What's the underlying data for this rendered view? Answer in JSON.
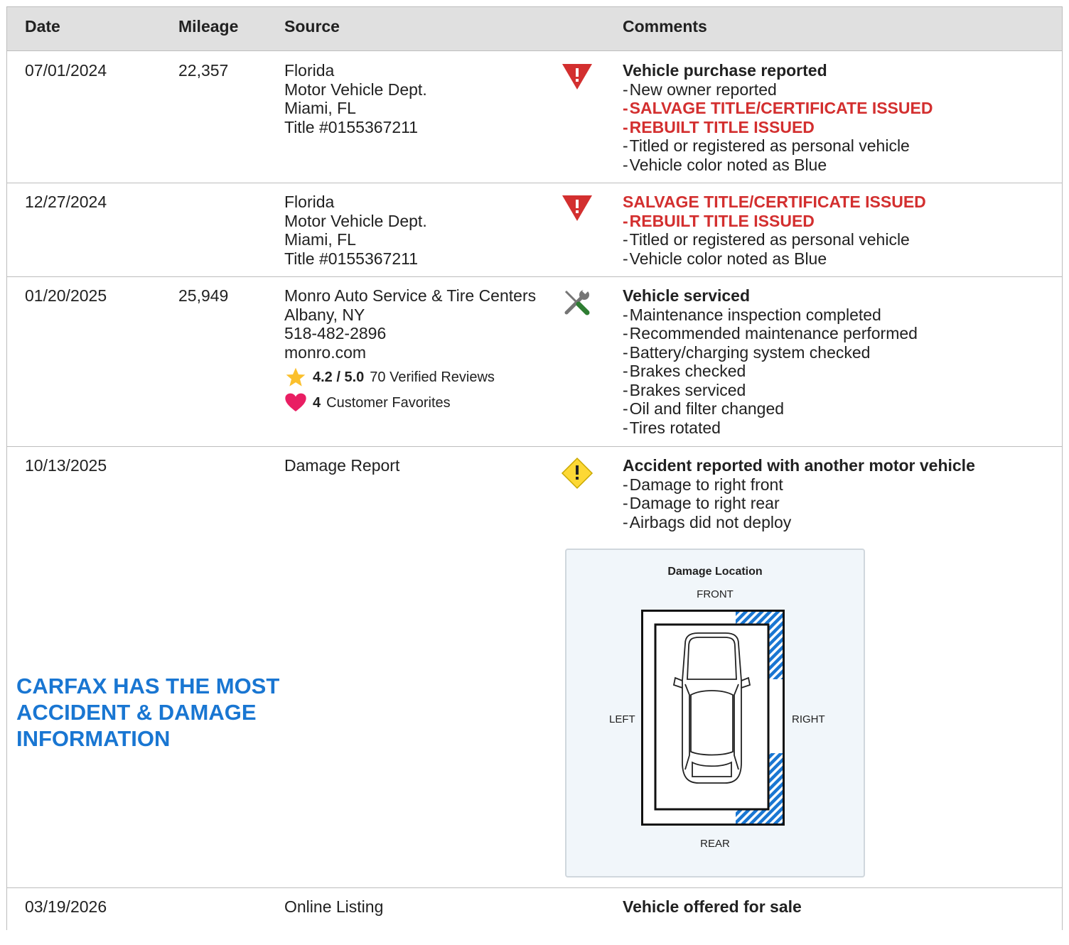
{
  "header": {
    "date": "Date",
    "mileage": "Mileage",
    "source": "Source",
    "comments": "Comments"
  },
  "rows": [
    {
      "date": "07/01/2024",
      "mileage": "22,357",
      "source": [
        "Florida",
        "Motor Vehicle Dept.",
        "Miami, FL",
        "Title #0155367211"
      ],
      "icon": "red-warning-icon",
      "title": "Vehicle purchase reported",
      "items": [
        {
          "text": "New owner reported",
          "alert": false
        },
        {
          "text": "SALVAGE TITLE/CERTIFICATE ISSUED",
          "alert": true
        },
        {
          "text": "REBUILT TITLE ISSUED",
          "alert": true
        },
        {
          "text": "Titled or registered as personal vehicle",
          "alert": false
        },
        {
          "text": "Vehicle color noted as Blue",
          "alert": false
        }
      ]
    },
    {
      "date": "12/27/2024",
      "mileage": "",
      "source": [
        "Florida",
        "Motor Vehicle Dept.",
        "Miami, FL",
        "Title #0155367211"
      ],
      "icon": "red-warning-icon",
      "title": "SALVAGE TITLE/CERTIFICATE ISSUED",
      "items": [
        {
          "text": "REBUILT TITLE ISSUED",
          "alert": true
        },
        {
          "text": "Titled or registered as personal vehicle",
          "alert": false
        },
        {
          "text": "Vehicle color noted as Blue",
          "alert": false
        }
      ]
    },
    {
      "date": "01/20/2025",
      "mileage": "25,949",
      "source": [
        "Monro Auto Service & Tire Centers",
        "Albany, NY",
        "518-482-2896",
        "monro.com"
      ],
      "rating": "4.2 / 5.0",
      "reviews": "70 Verified Reviews",
      "favorites_count": "4",
      "favorites_label": "Customer Favorites",
      "icon": "wrench-screwdriver-icon",
      "title": "Vehicle serviced",
      "items": [
        {
          "text": "Maintenance inspection completed",
          "alert": false
        },
        {
          "text": "Recommended maintenance performed",
          "alert": false
        },
        {
          "text": "Battery/charging system checked",
          "alert": false
        },
        {
          "text": "Brakes checked",
          "alert": false
        },
        {
          "text": "Brakes serviced",
          "alert": false
        },
        {
          "text": "Oil and filter changed",
          "alert": false
        },
        {
          "text": "Tires rotated",
          "alert": false
        }
      ]
    },
    {
      "date": "10/13/2025",
      "mileage": "",
      "source": [
        "Damage Report"
      ],
      "icon": "yellow-warning-icon",
      "title": "Accident reported with another motor vehicle",
      "items": [
        {
          "text": "Damage to right front",
          "alert": false
        },
        {
          "text": "Damage to right rear",
          "alert": false
        },
        {
          "text": "Airbags did not deploy",
          "alert": false
        }
      ]
    },
    {
      "date": "03/19/2026",
      "mileage": "",
      "source": [
        "Online Listing"
      ],
      "title": "Vehicle offered for sale"
    }
  ],
  "promo": [
    "CARFAX HAS THE MOST",
    "ACCIDENT & DAMAGE",
    "INFORMATION"
  ],
  "damage_diagram": {
    "title": "Damage Location",
    "front": "FRONT",
    "rear": "REAR",
    "left": "LEFT",
    "right": "RIGHT",
    "damaged_zones": [
      "right-front",
      "right-rear"
    ],
    "hatch_color": "#1976d2"
  },
  "colors": {
    "alert_red": "#d32f2f",
    "promo_blue": "#1976d2",
    "warning_yellow": "#fdd835",
    "star": "#fbc02d",
    "heart": "#e91e63"
  }
}
